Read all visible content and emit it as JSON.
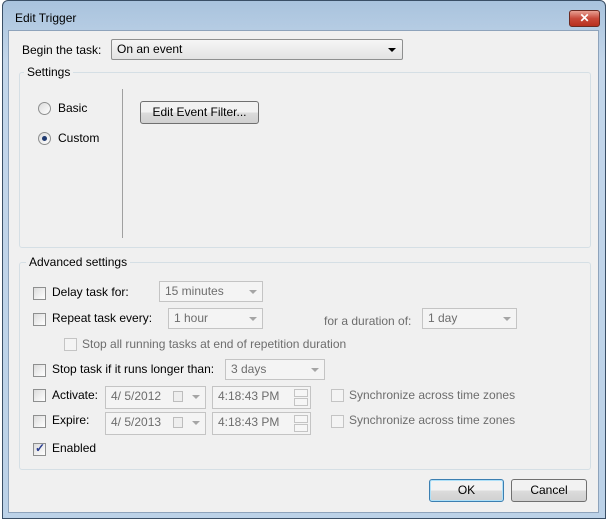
{
  "window": {
    "title": "Edit Trigger",
    "close_icon": "close-icon"
  },
  "begin": {
    "label": "Begin the task:",
    "value": "On an event"
  },
  "settings": {
    "label": "Settings",
    "basic": "Basic",
    "custom": "Custom",
    "selected": "Custom",
    "edit_filter": "Edit Event Filter..."
  },
  "advanced": {
    "label": "Advanced settings",
    "delay": {
      "label": "Delay task for:",
      "checked": false,
      "value": "15 minutes"
    },
    "repeat": {
      "label": "Repeat task every:",
      "checked": false,
      "value": "1 hour",
      "duration_label": "for a duration of:",
      "duration_value": "1 day"
    },
    "stop_all": {
      "label": "Stop all running tasks at end of repetition duration",
      "checked": false
    },
    "stop_longer": {
      "label": "Stop task if it runs longer than:",
      "checked": false,
      "value": "3 days"
    },
    "activate": {
      "label": "Activate:",
      "checked": false,
      "date": "4/  5/2012",
      "time": "4:18:43 PM",
      "sync": "Synchronize across time zones"
    },
    "expire": {
      "label": "Expire:",
      "checked": false,
      "date": "4/  5/2013",
      "time": "4:18:43 PM",
      "sync": "Synchronize across time zones"
    },
    "enabled": {
      "label": "Enabled",
      "checked": true
    }
  },
  "buttons": {
    "ok": "OK",
    "cancel": "Cancel"
  }
}
